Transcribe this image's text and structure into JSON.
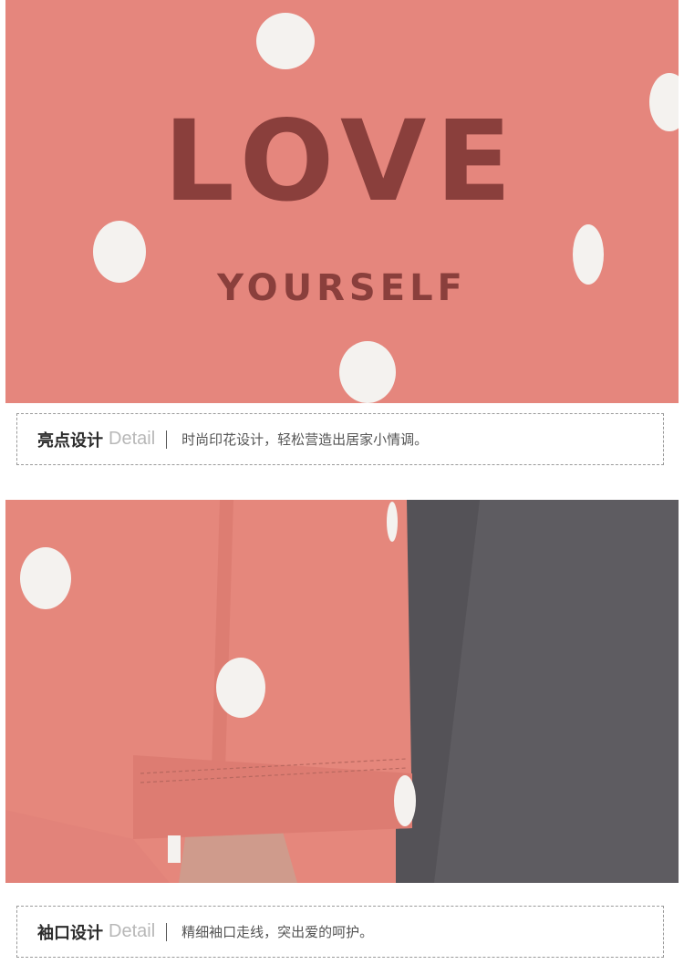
{
  "sections": [
    {
      "print": {
        "line1": "LOVE",
        "line2": "YOURSELF"
      },
      "caption": {
        "title": "亮点设计",
        "title_en": "Detail",
        "description": "时尚印花设计，轻松营造出居家小情调。"
      }
    },
    {
      "caption": {
        "title": "袖口设计",
        "title_en": "Detail",
        "description": "精细袖口走线，突出爱的呵护。"
      }
    }
  ],
  "colors": {
    "fabric_pink": "#e5867d",
    "polka_dot": "#f4f2ef",
    "print_brown": "#8a3f3c",
    "grey_fabric": "#5e5c61"
  }
}
